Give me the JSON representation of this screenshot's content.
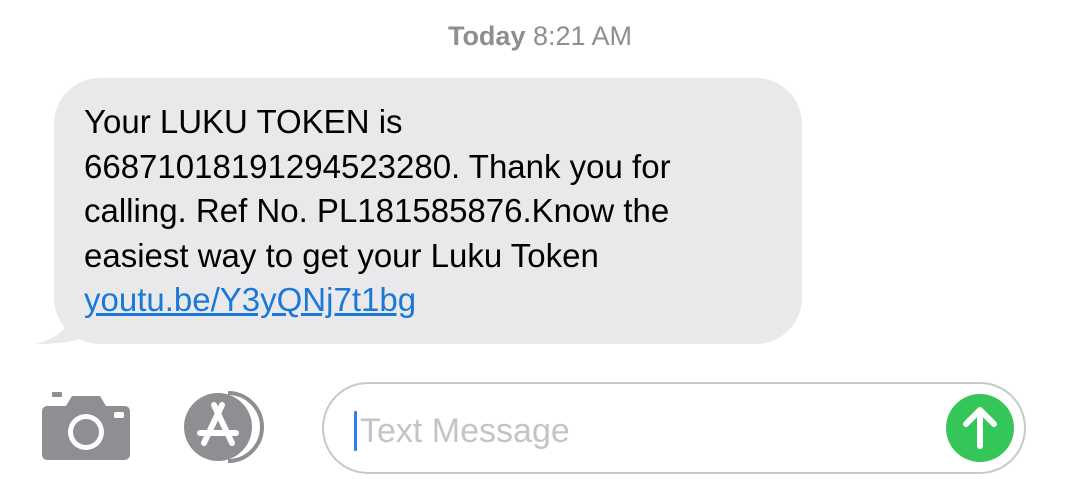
{
  "header": {
    "timestamp_day": "Today",
    "timestamp_time": "8:21 AM"
  },
  "message": {
    "lines": [
      "Your LUKU TOKEN is",
      "66871018191294523280. Thank you for",
      "calling. Ref No. PL181585876.Know the",
      "easiest way to get your Luku Token"
    ],
    "link_text": "youtu.be/Y3yQNj7t1bg",
    "bubble_color": "#e9e9eb",
    "link_color": "#1a78d6"
  },
  "compose": {
    "placeholder": "Text Message",
    "send_color": "#35c659",
    "camera_icon": "camera-icon",
    "appstore_icon": "app-store-icon",
    "send_icon": "arrow-up-icon"
  }
}
